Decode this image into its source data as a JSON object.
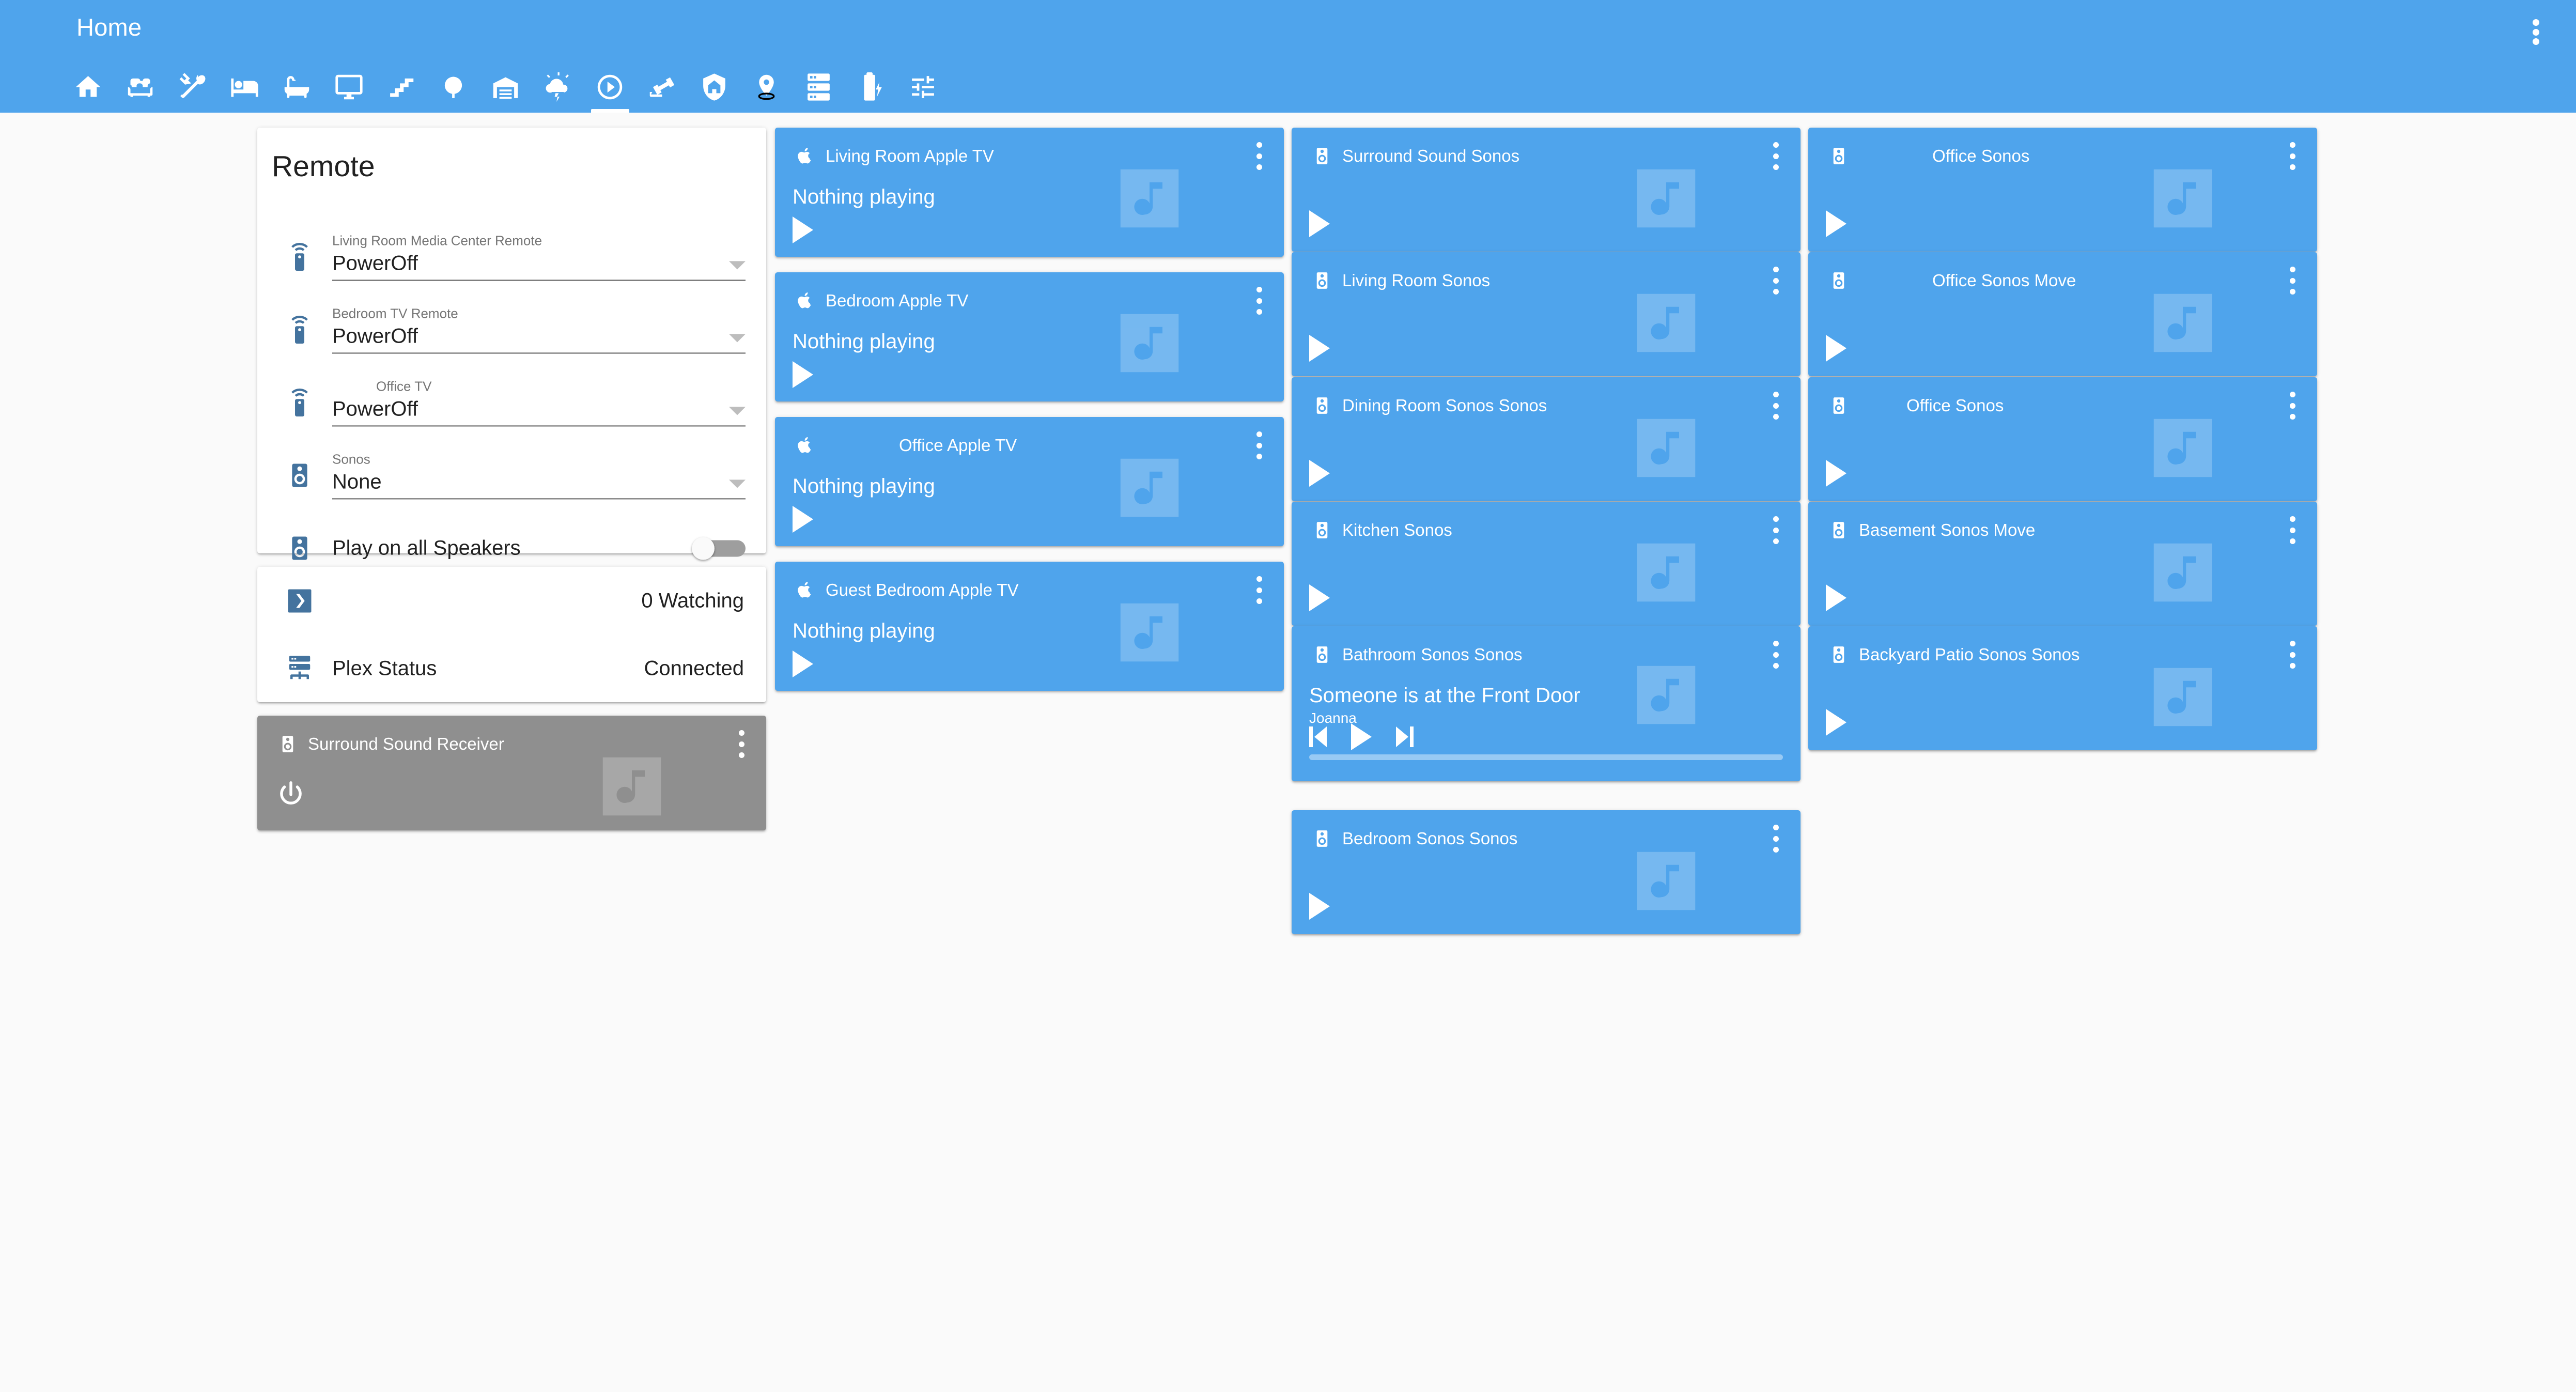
{
  "app": {
    "title": "Home",
    "overflow_icon": "dots-vertical-icon",
    "accent_color": "#4fa4ec",
    "background_color": "#fafafa"
  },
  "tabs": [
    {
      "icon": "home-icon",
      "name": "tab-home",
      "active": false
    },
    {
      "icon": "sofa-icon",
      "name": "tab-living-room",
      "active": false
    },
    {
      "icon": "silverware-fork-knife-icon",
      "name": "tab-dining",
      "active": false
    },
    {
      "icon": "bed-icon",
      "name": "tab-bedroom",
      "active": false
    },
    {
      "icon": "bathtub-icon",
      "name": "tab-bathroom",
      "active": false
    },
    {
      "icon": "monitor-icon",
      "name": "tab-office",
      "active": false
    },
    {
      "icon": "stairs-icon",
      "name": "tab-stairs",
      "active": false
    },
    {
      "icon": "tree-icon",
      "name": "tab-outdoors",
      "active": false
    },
    {
      "icon": "garage-icon",
      "name": "tab-garage",
      "active": false
    },
    {
      "icon": "weather-lightning-icon",
      "name": "tab-weather",
      "active": false
    },
    {
      "icon": "play-circle-outline-icon",
      "name": "tab-media",
      "active": true
    },
    {
      "icon": "cctv-icon",
      "name": "tab-cameras",
      "active": false
    },
    {
      "icon": "shield-home-icon",
      "name": "tab-security",
      "active": false
    },
    {
      "icon": "map-marker-icon",
      "name": "tab-presence",
      "active": false
    },
    {
      "icon": "server-icon",
      "name": "tab-system",
      "active": false
    },
    {
      "icon": "battery-charging-icon",
      "name": "tab-battery",
      "active": false
    },
    {
      "icon": "tune-icon",
      "name": "tab-settings",
      "active": false
    }
  ],
  "remote_card": {
    "title": "Remote",
    "rows": [
      {
        "icon": "remote-icon",
        "label": "Living Room Media Center Remote",
        "value": "PowerOff",
        "type": "select",
        "indent": false
      },
      {
        "icon": "remote-icon",
        "label": "Bedroom TV Remote",
        "value": "PowerOff",
        "type": "select",
        "indent": false
      },
      {
        "icon": "remote-icon",
        "label": "Office TV",
        "value": "PowerOff",
        "type": "select",
        "indent": true
      },
      {
        "icon": "speaker-icon",
        "label": "Sonos",
        "value": "None",
        "type": "select",
        "indent": false
      },
      {
        "icon": "speaker-icon",
        "label": "Play on all Speakers",
        "value": "off",
        "type": "toggle",
        "indent": false
      }
    ]
  },
  "plex_card": {
    "rows": [
      {
        "icon": "plex-icon",
        "name": "",
        "state": "0 Watching"
      },
      {
        "icon": "server-network-icon",
        "name": "Plex Status",
        "state": "Connected"
      }
    ]
  },
  "media_players": {
    "column1": [
      {
        "title": "Surround Sound Receiver",
        "icon": "speaker-icon",
        "theme": "grey",
        "art_icon": "music-box-icon",
        "overflow_icon": "dots-vertical-icon",
        "controls": [
          "power"
        ],
        "title_indent": "none"
      }
    ],
    "column2": [
      {
        "title": "Living Room Apple TV",
        "icon": "apple-icon",
        "theme": "blue",
        "status": "Nothing playing",
        "art_icon": "music-box-icon",
        "overflow_icon": "dots-vertical-icon",
        "controls": [
          "play"
        ],
        "title_indent": "none"
      },
      {
        "title": "Bedroom Apple TV",
        "icon": "apple-icon",
        "theme": "blue",
        "status": "Nothing playing",
        "art_icon": "music-box-icon",
        "overflow_icon": "dots-vertical-icon",
        "controls": [
          "play"
        ],
        "title_indent": "none"
      },
      {
        "title": "Office Apple TV",
        "icon": "apple-icon",
        "theme": "blue",
        "status": "Nothing playing",
        "art_icon": "music-box-icon",
        "overflow_icon": "dots-vertical-icon",
        "controls": [
          "play"
        ],
        "title_indent": "wide"
      },
      {
        "title": "Guest Bedroom Apple TV",
        "icon": "apple-icon",
        "theme": "blue",
        "status": "Nothing playing",
        "art_icon": "music-box-icon",
        "overflow_icon": "dots-vertical-icon",
        "controls": [
          "play"
        ],
        "title_indent": "none"
      }
    ],
    "column3": [
      {
        "title": "Surround Sound Sonos",
        "icon": "speaker-icon",
        "theme": "blue",
        "status": "",
        "art_icon": "music-box-icon",
        "overflow_icon": "dots-vertical-icon",
        "controls": [
          "play"
        ],
        "title_indent": "none"
      },
      {
        "title": "Living Room Sonos",
        "icon": "speaker-icon",
        "theme": "blue",
        "status": "",
        "art_icon": "music-box-icon",
        "overflow_icon": "dots-vertical-icon",
        "controls": [
          "play"
        ],
        "title_indent": "none"
      },
      {
        "title": "Dining Room Sonos Sonos",
        "icon": "speaker-icon",
        "theme": "blue",
        "status": "",
        "art_icon": "music-box-icon",
        "overflow_icon": "dots-vertical-icon",
        "controls": [
          "play"
        ],
        "title_indent": "none"
      },
      {
        "title": "Kitchen Sonos",
        "icon": "speaker-icon",
        "theme": "blue",
        "status": "",
        "art_icon": "music-box-icon",
        "overflow_icon": "dots-vertical-icon",
        "controls": [
          "play"
        ],
        "title_indent": "none"
      },
      {
        "title": "Bathroom Sonos Sonos",
        "icon": "speaker-icon",
        "theme": "blue",
        "status": "Someone is at the Front Door",
        "subtitle": "Joanna",
        "art_icon": "music-box-icon",
        "overflow_icon": "dots-vertical-icon",
        "controls": [
          "previous",
          "play",
          "next"
        ],
        "progress": 100,
        "title_indent": "none"
      },
      {
        "title": "Bedroom Sonos Sonos",
        "icon": "speaker-icon",
        "theme": "blue",
        "status": "",
        "art_icon": "music-box-icon",
        "overflow_icon": "dots-vertical-icon",
        "controls": [
          "play"
        ],
        "title_indent": "none"
      }
    ],
    "column4": [
      {
        "title": "Office Sonos",
        "icon": "speaker-icon",
        "theme": "blue",
        "status": "",
        "art_icon": "music-box-icon",
        "overflow_icon": "dots-vertical-icon",
        "controls": [
          "play"
        ],
        "title_indent": "wide"
      },
      {
        "title": "Office Sonos Move",
        "icon": "speaker-icon",
        "theme": "blue",
        "status": "",
        "art_icon": "music-box-icon",
        "overflow_icon": "dots-vertical-icon",
        "controls": [
          "play"
        ],
        "title_indent": "wide"
      },
      {
        "title": "Office Sonos",
        "icon": "speaker-icon",
        "theme": "blue",
        "status": "",
        "art_icon": "music-box-icon",
        "overflow_icon": "dots-vertical-icon",
        "controls": [
          "play"
        ],
        "title_indent": "narrow"
      },
      {
        "title": "Basement Sonos Move",
        "icon": "speaker-icon",
        "theme": "blue",
        "status": "",
        "art_icon": "music-box-icon",
        "overflow_icon": "dots-vertical-icon",
        "controls": [
          "play"
        ],
        "title_indent": "none"
      },
      {
        "title": "Backyard Patio Sonos Sonos",
        "icon": "speaker-icon",
        "theme": "blue",
        "status": "",
        "art_icon": "music-box-icon",
        "overflow_icon": "dots-vertical-icon",
        "controls": [
          "play"
        ],
        "title_indent": "none"
      }
    ]
  }
}
